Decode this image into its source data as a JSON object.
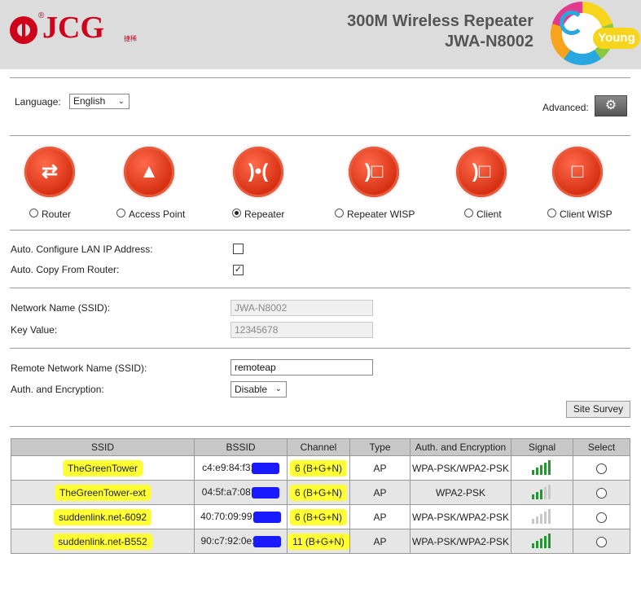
{
  "header": {
    "brand": "JCG",
    "brand_reg": "®",
    "brand_cn": "捷稀",
    "title": "300M Wireless Repeater",
    "model": "JWA-N8002",
    "young_logo_text": "Young",
    "accent_color": "#d0021b"
  },
  "language": {
    "label": "Language:",
    "selected": "English",
    "chevron_icon": "chevron-down-icon"
  },
  "advanced": {
    "label": "Advanced:",
    "icon": "gear-icon"
  },
  "modes": [
    {
      "label": "Router",
      "selected": false,
      "icon": "router-icon"
    },
    {
      "label": "Access Point",
      "selected": false,
      "icon": "access-point-icon"
    },
    {
      "label": "Repeater",
      "selected": true,
      "icon": "repeater-icon"
    },
    {
      "label": "Repeater WISP",
      "selected": false,
      "icon": "repeater-wisp-icon"
    },
    {
      "label": "Client",
      "selected": false,
      "icon": "client-icon"
    },
    {
      "label": "Client WISP",
      "selected": false,
      "icon": "client-wisp-icon"
    }
  ],
  "options": {
    "auto_lan_label": "Auto. Configure LAN IP Address:",
    "auto_lan_checked": false,
    "auto_copy_label": "Auto. Copy From Router:",
    "auto_copy_checked": true
  },
  "local": {
    "ssid_label": "Network Name (SSID):",
    "ssid_value": "JWA-N8002",
    "key_label": "Key Value:",
    "key_value": "12345678"
  },
  "remote": {
    "ssid_label": "Remote Network Name (SSID):",
    "ssid_value": "remoteap",
    "auth_label": "Auth. and Encryption:",
    "auth_value": "Disable",
    "survey_button": "Site Survey"
  },
  "table": {
    "headers": [
      "SSID",
      "BSSID",
      "Channel",
      "Type",
      "Auth. and Encryption",
      "Signal",
      "Select"
    ],
    "rows": [
      {
        "ssid": "TheGreenTower",
        "bssid": "c4:e9:84:f3:",
        "channel": "6 (B+G+N)",
        "type": "AP",
        "auth": "WPA-PSK/WPA2-PSK",
        "signal": 5
      },
      {
        "ssid": "TheGreenTower-ext",
        "bssid": "04:5f:a7:08:",
        "channel": "6 (B+G+N)",
        "type": "AP",
        "auth": "WPA2-PSK",
        "signal": 3
      },
      {
        "ssid": "suddenlink.net-6092",
        "bssid": "40:70:09:99:",
        "channel": "6 (B+G+N)",
        "type": "AP",
        "auth": "WPA-PSK/WPA2-PSK",
        "signal": 0
      },
      {
        "ssid": "suddenlink.net-B552",
        "bssid": "90:c7:92:0e:",
        "channel": "11 (B+G+N)",
        "type": "AP",
        "auth": "WPA-PSK/WPA2-PSK",
        "signal": 5
      }
    ],
    "signal_on_color": "#1f9a2f",
    "signal_off_color": "#c8c8c8",
    "highlight_color": "#ffff33",
    "redaction_color": "#1a1aff"
  }
}
